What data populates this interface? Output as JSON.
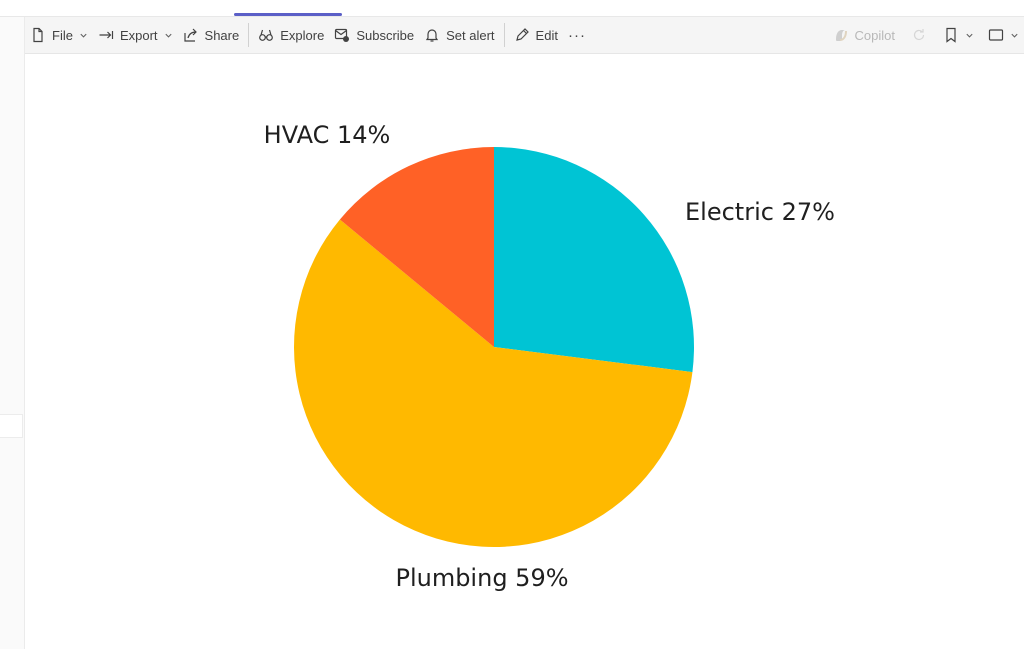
{
  "toolbar": {
    "file_label": "File",
    "export_label": "Export",
    "share_label": "Share",
    "explore_label": "Explore",
    "subscribe_label": "Subscribe",
    "set_alert_label": "Set alert",
    "edit_label": "Edit",
    "more_label": "···",
    "copilot_label": "Copilot"
  },
  "icons": {
    "file": "document-icon",
    "export": "export-arrow-icon",
    "share": "share-icon",
    "explore": "binoculars-icon",
    "subscribe": "subscribe-icon",
    "set_alert": "bell-icon",
    "edit": "pencil-icon",
    "copilot": "copilot-icon",
    "bookmark": "bookmark-icon",
    "view": "view-window-icon"
  },
  "colors": {
    "accent": "#5b5fc7",
    "electric": "#00c4d4",
    "hvac": "#ff6126",
    "plumbing": "#ffb900"
  },
  "chart_data": {
    "type": "pie",
    "title": "",
    "slices": [
      {
        "label": "Electric 27%",
        "value": 27,
        "color": "#00c4d4"
      },
      {
        "label": "Plumbing 59%",
        "value": 59,
        "color": "#ffb900"
      },
      {
        "label": "HVAC 14%",
        "value": 14,
        "color": "#ff6126"
      }
    ]
  }
}
